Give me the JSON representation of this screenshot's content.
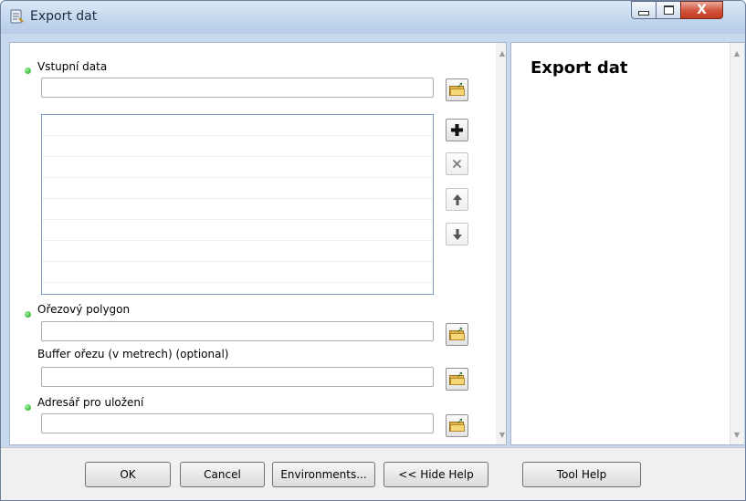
{
  "window": {
    "title": "Export dat",
    "icon": "toolbox-icon",
    "controls": [
      "minimize-icon",
      "maximize-icon",
      "close-icon"
    ],
    "close_glyph": "X"
  },
  "form": {
    "fields": [
      {
        "label": "Vstupní data",
        "required": true,
        "value": "",
        "browse_icon": "folder-open-icon"
      },
      {
        "label": "Ořezový polygon",
        "required": true,
        "value": "",
        "browse_icon": "folder-open-icon"
      },
      {
        "label": "Buffer ořezu (v metrech) (optional)",
        "required": false,
        "value": "",
        "browse_icon": "folder-open-icon"
      },
      {
        "label": "Adresář pro uložení",
        "required": true,
        "value": "",
        "browse_icon": "folder-open-icon"
      }
    ],
    "list_rows": [
      "",
      "",
      "",
      "",
      "",
      "",
      "",
      "",
      ""
    ],
    "list_buttons": {
      "add_icon": "plus-icon",
      "remove_icon": "x-icon",
      "up_icon": "arrow-up-icon",
      "down_icon": "arrow-down-icon"
    }
  },
  "help": {
    "title": "Export dat"
  },
  "buttons": {
    "ok": "OK",
    "cancel": "Cancel",
    "environments": "Environments...",
    "hide_help": "<< Hide Help",
    "tool_help": "Tool Help"
  },
  "colors": {
    "title_bar": "#c3d7ee",
    "close_button": "#c94a30",
    "required_bullet": "#1aa31a",
    "bottom_bar": "#f0f0f0"
  }
}
